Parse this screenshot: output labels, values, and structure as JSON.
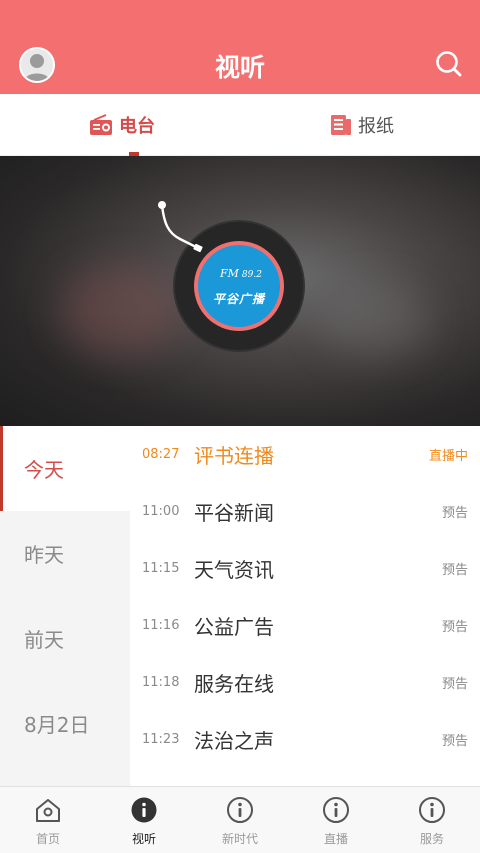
{
  "header": {
    "title": "视听"
  },
  "tabs": [
    {
      "label": "电台",
      "icon": "radio-icon",
      "active": true
    },
    {
      "label": "报纸",
      "icon": "newspaper-icon",
      "active": false
    }
  ],
  "banner": {
    "fm_label": "FM",
    "frequency": "89.2",
    "station_name": "平谷广播",
    "colors": {
      "ring": "#f07070",
      "disc": "#1a98d8"
    }
  },
  "days": [
    {
      "label": "今天",
      "active": true
    },
    {
      "label": "昨天",
      "active": false
    },
    {
      "label": "前天",
      "active": false
    },
    {
      "label": "8月2日",
      "active": false
    }
  ],
  "programs": [
    {
      "time": "08:27",
      "name": "评书连播",
      "status": "直播中",
      "live": true
    },
    {
      "time": "11:00",
      "name": "平谷新闻",
      "status": "预告",
      "live": false
    },
    {
      "time": "11:15",
      "name": "天气资讯",
      "status": "预告",
      "live": false
    },
    {
      "time": "11:16",
      "name": "公益广告",
      "status": "预告",
      "live": false
    },
    {
      "time": "11:18",
      "name": "服务在线",
      "status": "预告",
      "live": false
    },
    {
      "time": "11:23",
      "name": "法治之声",
      "status": "预告",
      "live": false
    }
  ],
  "nav": [
    {
      "label": "首页",
      "icon": "home-icon",
      "active": false
    },
    {
      "label": "视听",
      "icon": "info-icon",
      "active": true
    },
    {
      "label": "新时代",
      "icon": "info-icon",
      "active": false
    },
    {
      "label": "直播",
      "icon": "info-icon",
      "active": false
    },
    {
      "label": "服务",
      "icon": "info-icon",
      "active": false
    }
  ],
  "colors": {
    "brand": "#f47070",
    "accent_red": "#d44b4b",
    "live_orange": "#f08a1c"
  }
}
